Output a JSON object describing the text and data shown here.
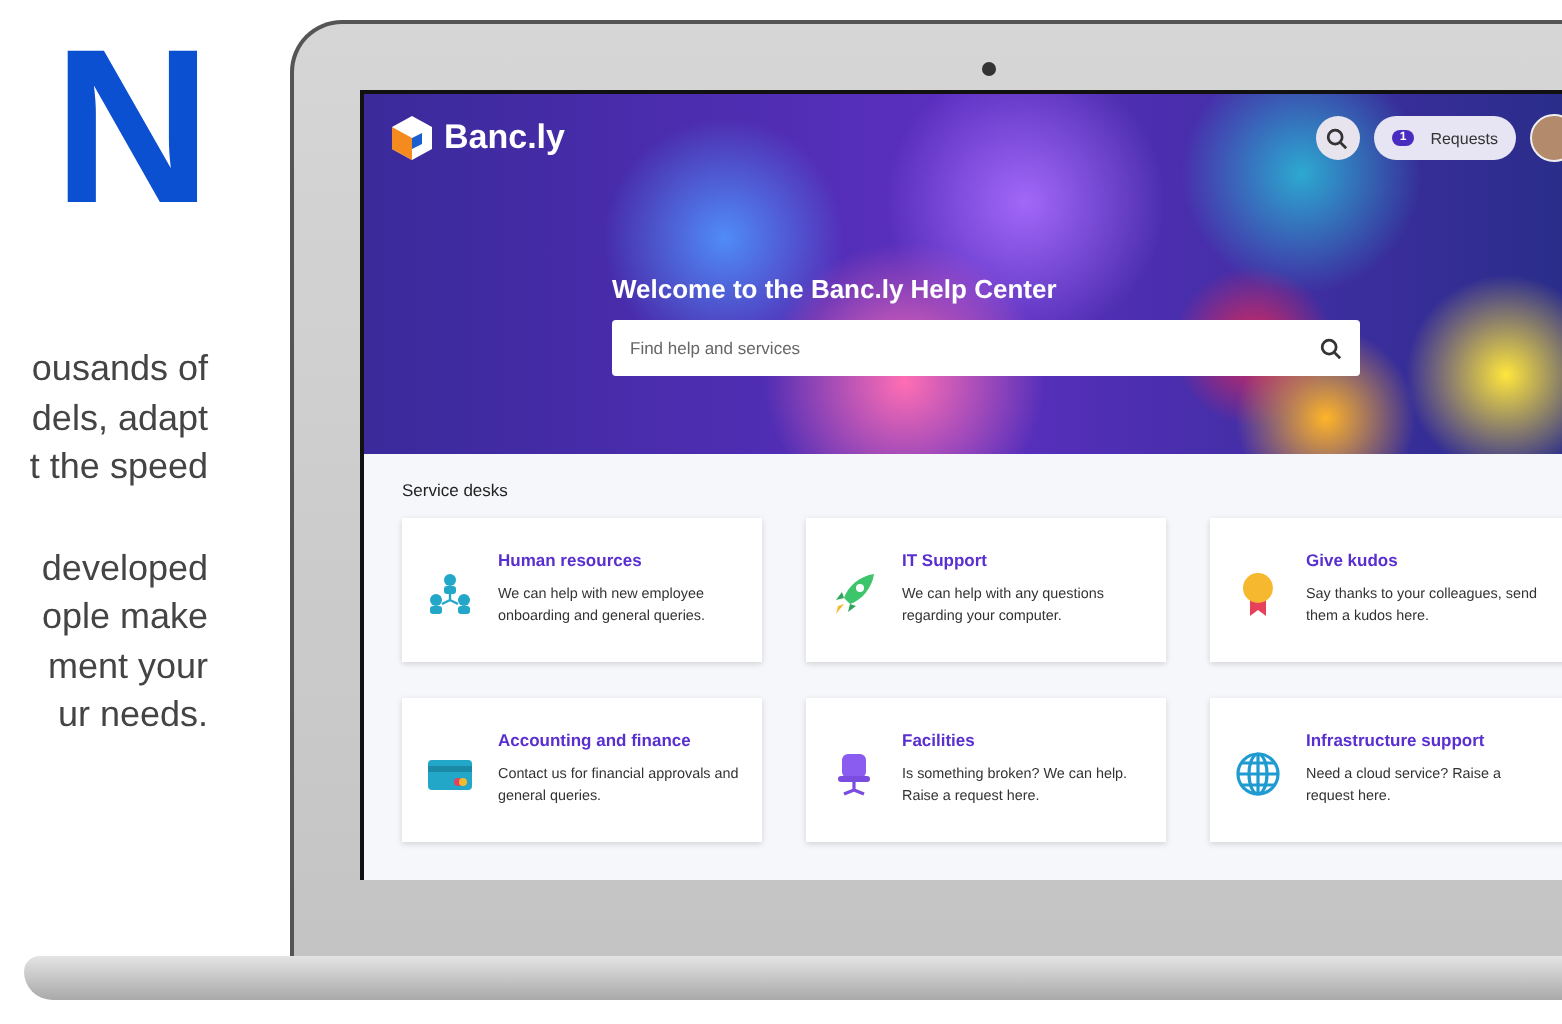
{
  "promo": {
    "heading": "N",
    "paragraphs": [
      [
        "ousands of",
        "dels, adapt",
        "t the speed"
      ],
      [
        "developed",
        "ople make",
        "ment your",
        "ur needs."
      ]
    ]
  },
  "help_center": {
    "logo": "Banc.ly",
    "requests": {
      "count": "1",
      "label": "Requests"
    },
    "welcome": "Welcome to the Banc.ly Help Center",
    "search": {
      "placeholder": "Find help and services"
    },
    "section_title": "Service desks",
    "desks": [
      {
        "title": "Human resources",
        "description": "We can help with new employee onboarding and general queries."
      },
      {
        "title": "IT Support",
        "description": "We can help with any questions regarding your computer."
      },
      {
        "title": "Give kudos",
        "description": "Say thanks to your colleagues, send them a kudos here."
      },
      {
        "title": "Accounting and finance",
        "description": "Contact us for financial approvals and general queries."
      },
      {
        "title": "Facilities",
        "description": "Is something broken? We can help. Raise a request here."
      },
      {
        "title": "Infrastructure support",
        "description": "Need a cloud service? Raise a request here."
      }
    ]
  }
}
